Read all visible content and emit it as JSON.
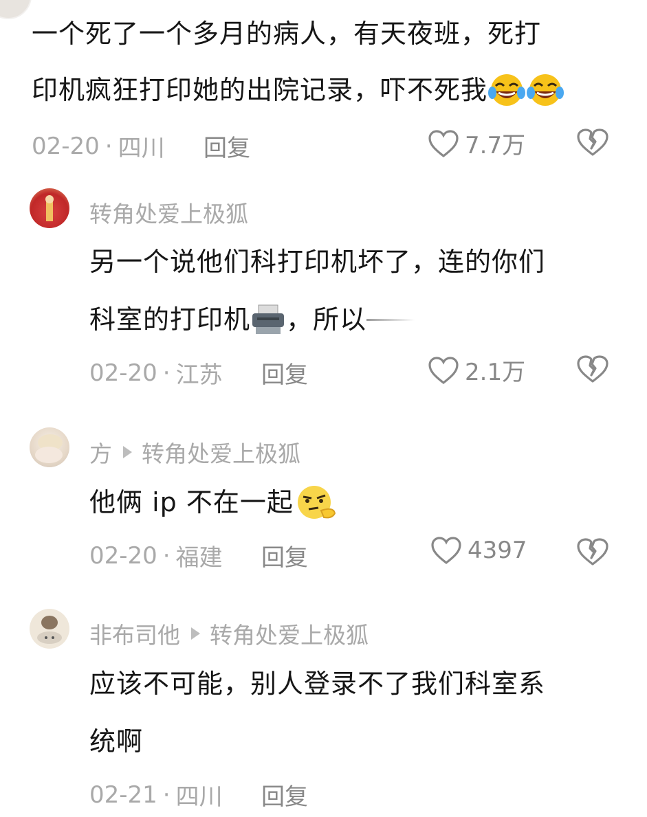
{
  "comments": [
    {
      "text_lines": [
        "一个死了一个多月的病人，有天夜班，死打",
        "印机疯狂打印她的出院记录，吓不死我"
      ],
      "date": "02-20",
      "location": "四川",
      "reply_label": "回复",
      "likes": "7.7万",
      "emoji": "laughing-crying-emoji"
    },
    {
      "username": "转角处爱上极狐",
      "text_lines": [
        "另一个说他们科打印机坏了，连的你们",
        "科室的打印机",
        "，所以"
      ],
      "date": "02-20",
      "location": "江苏",
      "reply_label": "回复",
      "likes": "2.1万",
      "emoji": "printer-emoji"
    },
    {
      "username": "方",
      "reply_to": "转角处爱上极狐",
      "text_lines": [
        "他俩 ip 不在一起"
      ],
      "date": "02-20",
      "location": "福建",
      "reply_label": "回复",
      "likes": "4397",
      "emoji": "thinking-face-emoji"
    },
    {
      "username": "非布司他",
      "reply_to": "转角处爱上极狐",
      "text_lines": [
        "应该不可能，别人登录不了我们科室系",
        "统啊"
      ],
      "date": "02-21",
      "location": "四川",
      "reply_label": "回复"
    }
  ],
  "colors": {
    "text": "#161616",
    "meta": "#a9a9a9",
    "icon": "#888888"
  }
}
